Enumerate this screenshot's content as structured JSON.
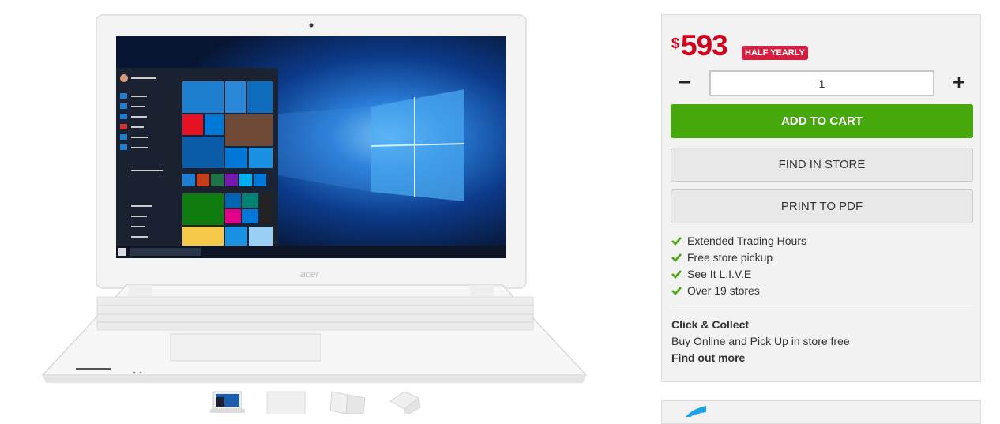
{
  "product": {
    "image_alt": "acer laptop",
    "brand_logo": "acer",
    "thumbnails": [
      "front-view",
      "closed-view",
      "angle-view",
      "back-view"
    ]
  },
  "purchase": {
    "currency_symbol": "$",
    "price": "593",
    "badge": "HALF YEARLY",
    "quantity": "1",
    "minus_label": "−",
    "plus_label": "+",
    "add_to_cart": "ADD TO CART",
    "find_in_store": "FIND IN STORE",
    "print_to_pdf": "PRINT TO PDF"
  },
  "features": [
    "Extended Trading Hours",
    "Free store pickup",
    "See It L.I.V.E",
    "Over 19 stores"
  ],
  "click_collect": {
    "title": "Click & Collect",
    "description": "Buy Online and Pick Up in store free",
    "link": "Find out more"
  },
  "colors": {
    "price": "#d0021b",
    "badge": "#d41f41",
    "cart_button": "#46a80a",
    "check": "#46a80a",
    "panel_bg": "#f2f2f2"
  },
  "icons": [
    "check-icon",
    "minus-icon",
    "plus-icon",
    "windows-logo-icon"
  ]
}
